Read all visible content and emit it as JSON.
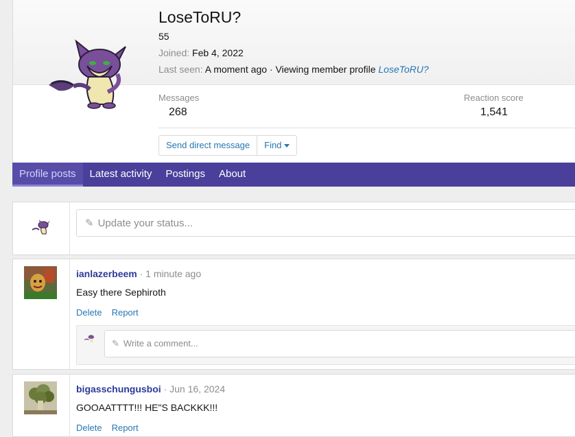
{
  "profile": {
    "name": "LoseToRU?",
    "title": "55",
    "joined_label": "Joined:",
    "joined_value": "Feb 4, 2022",
    "last_seen_label": "Last seen:",
    "last_seen_value": "A moment ago · Viewing member profile",
    "last_seen_link": "LoseToRU?",
    "stats": {
      "messages_label": "Messages",
      "messages_value": "268",
      "reaction_label": "Reaction score",
      "reaction_value": "1,541"
    },
    "buttons": {
      "send_message": "Send direct message",
      "find": "Find"
    }
  },
  "tabs": [
    {
      "label": "Profile posts"
    },
    {
      "label": "Latest activity"
    },
    {
      "label": "Postings"
    },
    {
      "label": "About"
    }
  ],
  "status_box": {
    "placeholder": "Update your status..."
  },
  "posts": [
    {
      "author": "ianlazerbeem",
      "time": "1 minute ago",
      "text": "Easy there Sephiroth",
      "actions": [
        "Delete",
        "Report"
      ],
      "comment_placeholder": "Write a comment..."
    },
    {
      "author": "bigasschungusboi",
      "time": "Jun 16, 2024",
      "text": "GOOAATTTT!!! HE\"S BACKKK!!!",
      "actions": [
        "Delete",
        "Report"
      ]
    }
  ],
  "colors": {
    "accent": "#4a3f9a",
    "link": "#2577b1",
    "username": "#2c3a98"
  }
}
